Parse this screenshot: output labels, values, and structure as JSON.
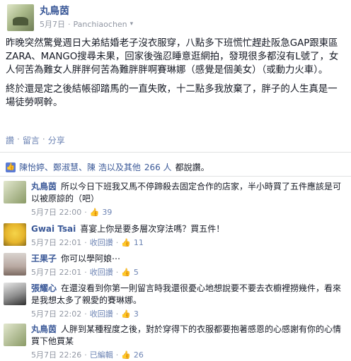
{
  "post": {
    "author": "丸鳥茵",
    "date": "5月7日",
    "separator": "·",
    "location": "Panchiaochen",
    "flag_icon": "globe-icon",
    "paragraphs": [
      "昨晚突然驚覺週日大弟結婚老子沒衣服穿，八點多下班慌忙趕赴阪急GAP跟東區ZARA、MANGO搜尋未果，回家後強忍睡意逛網拍，發現很多都沒有L號了，女人何苦為難女人胖胖何苦為難胖胖啊賽琳娜（感覺是個美女）（或動力火車）。",
      "終於還是定之後結帳卻踏馬的一直失敗，十二點多我放棄了，胖子的人生真是一場徒勞啊幹。"
    ],
    "actions": [
      "讚",
      "留言",
      "分享"
    ],
    "likes_text_prefix": "陳怡婷、鄭淑慧、陳 浩以及其他",
    "likes_count": "266 人",
    "likes_text_suffix": "都說讚。"
  },
  "comments": [
    {
      "name": "丸鳥茵",
      "text": "所以今日下班我又馬不停蹄殺去固定合作的店家，半小時買了五件應該是可以被原諒的（吧）",
      "date": "5月7日 22:00",
      "actions": [],
      "likes": "39",
      "avatar": "av1"
    },
    {
      "name": "Gwai Tsai",
      "text": "喜宴上你是要多層次穿法嗎？買五件！",
      "date": "5月7日 22:01",
      "actions": [
        "收回讚"
      ],
      "likes": "11",
      "avatar": "av2"
    },
    {
      "name": "王果子",
      "text": "你可以學阿娘⋯",
      "date": "5月7日 22:01",
      "actions": [
        "收回讚"
      ],
      "likes": "5",
      "avatar": "av3"
    },
    {
      "name": "張耀心",
      "text": "在還沒看到你第一則留言時我還很憂心地想說要不要去衣櫥裡撈幾件，看來是我想太多了親愛的賽琳娜。",
      "date": "5月7日 22:02",
      "actions": [
        "收回讚"
      ],
      "likes": "3",
      "avatar": "av4"
    },
    {
      "name": "丸鳥茵",
      "text": "人胖到某種程度之後，對於穿得下的衣服都要抱著感恩的心感謝有你的心情買下他買某",
      "date": "5月7日 22:26",
      "actions": [
        "已編輯"
      ],
      "likes": "26",
      "avatar": "av5"
    }
  ],
  "ui": {
    "meta_sep": "·",
    "like_icon": "thumbs-up-icon"
  }
}
